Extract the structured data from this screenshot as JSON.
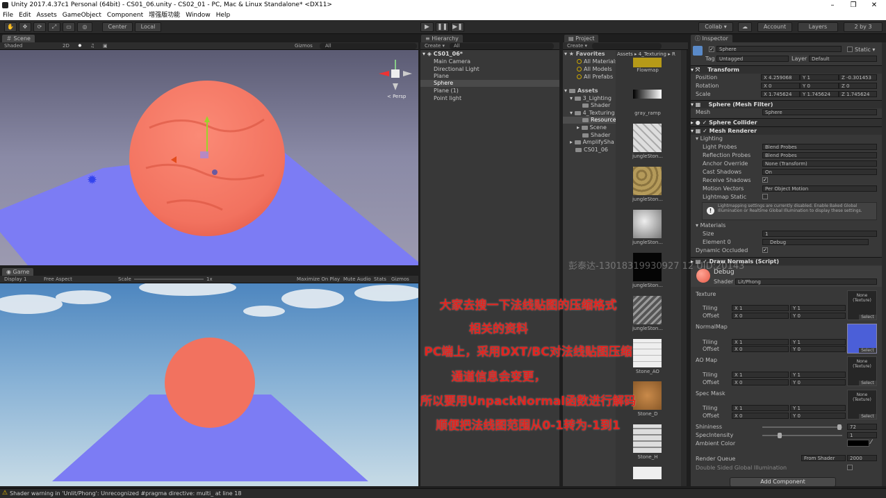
{
  "window": {
    "title": "Unity 2017.4.37c1 Personal (64bit) - CS01_06.unity - CS02_01 - PC, Mac & Linux Standalone* <DX11>",
    "minimize": "–",
    "maximize": "❐",
    "close": "✕"
  },
  "menu": [
    "File",
    "Edit",
    "Assets",
    "GameObject",
    "Component",
    "增强版功能",
    "Window",
    "Help"
  ],
  "toolbar": {
    "center": "Center",
    "local": "Local",
    "collab": "Collab ▾",
    "account": "Account",
    "layers": "Layers",
    "layout": "2 by 3"
  },
  "scene": {
    "tab": "Scene",
    "shaded": "Shaded",
    "mode2d": "2D",
    "gizmos": "Gizmos",
    "search": "All",
    "persp": "< Persp"
  },
  "game": {
    "tab": "Game",
    "display": "Display 1",
    "aspect": "Free Aspect",
    "scale_label": "Scale",
    "scale_value": "1x",
    "maximize": "Maximize On Play",
    "mute": "Mute Audio",
    "stats": "Stats",
    "gizmos": "Gizmos"
  },
  "hierarchy": {
    "tab": "Hierarchy",
    "create": "Create ▾",
    "search": "All",
    "scene_name": "CS01_06*",
    "items": [
      "Main Camera",
      "Directional Light",
      "Plane",
      "Sphere",
      "Plane (1)",
      "Point light"
    ],
    "selected": "Sphere"
  },
  "project": {
    "tab": "Project",
    "create": "Create ▾",
    "favorites": "Favorites",
    "fav_items": [
      "All Materials",
      "All Models",
      "All Prefabs"
    ],
    "assets": "Assets",
    "tree": [
      "3_Lighting",
      "Shader",
      "4_Texturing",
      "Resource",
      "Scene",
      "Shader",
      "AmplifySha",
      "CS01_06"
    ],
    "breadcrumb": "Assets ▸ 4_Texturing ▸ R",
    "thumbs": [
      {
        "label": "Flowmap"
      },
      {
        "label": "gray_ramp"
      },
      {
        "label": "jungleSton..."
      },
      {
        "label": "jungleSton..."
      },
      {
        "label": "jungleSton..."
      },
      {
        "label": "jungleSton..."
      },
      {
        "label": "jungleSton..."
      },
      {
        "label": "Stone_AO"
      },
      {
        "label": "Stone_D"
      },
      {
        "label": "Stone_H"
      }
    ]
  },
  "inspector": {
    "tab": "Inspector",
    "object_name": "Sphere",
    "static": "Static ▾",
    "tag_label": "Tag",
    "tag": "Untagged",
    "layer_label": "Layer",
    "layer": "Default",
    "transform": {
      "title": "Transform",
      "position": {
        "label": "Position",
        "x": "4.259068",
        "y": "1",
        "z": "-0.301453"
      },
      "rotation": {
        "label": "Rotation",
        "x": "0",
        "y": "0",
        "z": "0"
      },
      "scale": {
        "label": "Scale",
        "x": "1.745624",
        "y": "1.745624",
        "z": "1.745624"
      }
    },
    "mesh_filter": {
      "title": "Sphere (Mesh Filter)",
      "mesh_label": "Mesh",
      "mesh": "Sphere"
    },
    "collider": {
      "title": "Sphere Collider"
    },
    "renderer": {
      "title": "Mesh Renderer",
      "lighting": "Lighting",
      "rows": [
        {
          "label": "Light Probes",
          "value": "Blend Probes"
        },
        {
          "label": "Reflection Probes",
          "value": "Blend Probes"
        },
        {
          "label": "Anchor Override",
          "value": "None (Transform)"
        },
        {
          "label": "Cast Shadows",
          "value": "On"
        },
        {
          "label": "Receive Shadows",
          "value": "✓"
        },
        {
          "label": "Motion Vectors",
          "value": "Per Object Motion"
        },
        {
          "label": "Lightmap Static",
          "value": ""
        }
      ],
      "info": "Lightmapping settings are currently disabled. Enable Baked Global Illumination or Realtime Global Illumination to display these settings.",
      "materials": "Materials",
      "size_label": "Size",
      "size": "1",
      "element_label": "Element 0",
      "element": "Debug",
      "dynamic_label": "Dynamic Occluded"
    },
    "draw_normals": {
      "title": "Draw Normals (Script)"
    },
    "material": {
      "name": "Debug",
      "shader_label": "Shader",
      "shader": "Lit/Phong",
      "texture": {
        "label": "Texture",
        "slot": "None (Texture)"
      },
      "normalmap": {
        "label": "NormalMap"
      },
      "ao": {
        "label": "AO Map",
        "slot": "None (Texture)"
      },
      "spec": {
        "label": "Spec Mask",
        "slot": "None (Texture)"
      },
      "tiling": "Tiling",
      "offset": "Offset",
      "one": "1",
      "zero": "0",
      "x": "X",
      "y": "Y",
      "select": "Select",
      "shininess_label": "Shininess",
      "shininess": "72",
      "spec_label": "SpecIntensity",
      "spec_value": "1",
      "ambient_label": "Ambient Color",
      "render_queue_label": "Render Queue",
      "render_queue_mode": "From Shader",
      "render_queue": "2000",
      "double_sided": "Double Sided Global Illumination"
    },
    "add_component": "Add Component"
  },
  "watermark": "彭泰达-13018319930927 12 UID:20143",
  "overlay": [
    "大家去搜一下法线贴图的压缩格式",
    "相关的资料",
    "PC端上，采用DXT/BC对法线贴图压缩",
    "通道信息会变更，",
    "所以要用UnpackNormal函数进行解码",
    "顺便把法线图范围从0-1转为-1到1"
  ],
  "status": "Shader warning in 'Unlit/Phong': Unrecognized #pragma directive: multi_ at line 18",
  "colors": {
    "sphere": "#f47a66",
    "plane": "#7f7ff5",
    "overlay": "#e2241f",
    "panel": "#383838"
  }
}
